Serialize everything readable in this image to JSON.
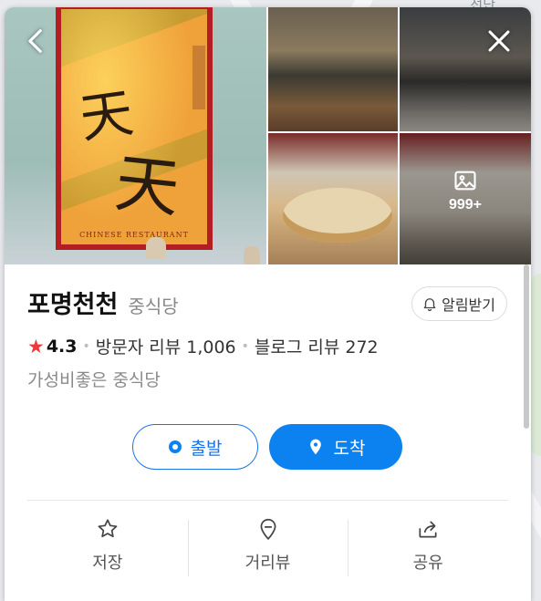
{
  "map": {
    "label": "선단"
  },
  "photos": {
    "more_count": "999+",
    "poster_glyph_top": "天",
    "poster_glyph_bottom": "天",
    "poster_caption": "CHINESE RESTAURANT"
  },
  "place": {
    "name": "포명천천",
    "category": "중식당",
    "alert_label": "알림받기",
    "rating": "4.3",
    "visitor_reviews": "방문자 리뷰 1,006",
    "blog_reviews": "블로그 리뷰 272",
    "description": "가성비좋은 중식당"
  },
  "route": {
    "start_label": "출발",
    "arrive_label": "도착"
  },
  "actions": {
    "save_label": "저장",
    "street_view_label": "거리뷰",
    "share_label": "공유"
  },
  "colors": {
    "accent": "#0b82f0",
    "star": "#ec3a3a"
  }
}
